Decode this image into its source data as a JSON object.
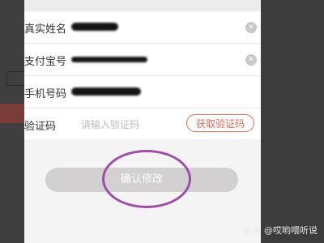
{
  "form": {
    "rows": [
      {
        "label": "真实姓名"
      },
      {
        "label": "支付宝号"
      },
      {
        "label": "手机号码"
      },
      {
        "label": "验证码",
        "placeholder": "请输入验证码"
      }
    ],
    "clear_icon_glyph": "✕",
    "get_code_label": "获取验证码"
  },
  "confirm_button_label": "确认修改",
  "watermark": "头条 @哎哟喂听说",
  "colors": {
    "accent": "#e06e5c",
    "highlight_ring": "#9c4ea8",
    "disabled_button": "#d2d0d1"
  }
}
